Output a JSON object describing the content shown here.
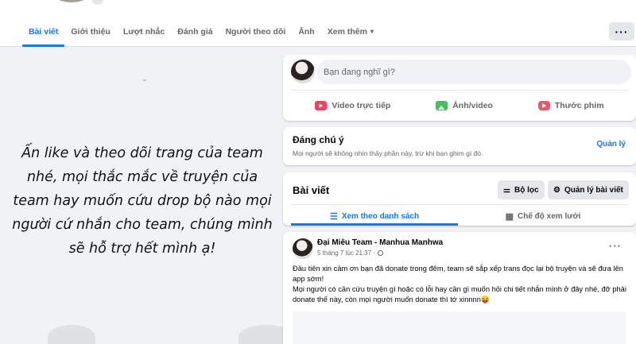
{
  "tabs": [
    {
      "label": "Bài viết",
      "active": true
    },
    {
      "label": "Giới thiệu"
    },
    {
      "label": "Lượt nhắc"
    },
    {
      "label": "Đánh giá"
    },
    {
      "label": "Người theo dõi"
    },
    {
      "label": "Ảnh"
    },
    {
      "label": "Xem thêm",
      "caret": "▾"
    }
  ],
  "more_button": "···",
  "left_banner": {
    "text": "Ấn like và theo dõi trang của team nhé, mọi thắc mắc về truyện của team hay muốn cứu drop bộ nào mọi người cứ nhắn cho team, chúng mình sẽ hỗ trợ hết mình ạ!"
  },
  "composer": {
    "placeholder": "Bạn đang nghĩ gì?",
    "actions": [
      {
        "label": "Video trực tiếp",
        "icon": "live-video-icon"
      },
      {
        "label": "Ảnh/video",
        "icon": "photo-icon"
      },
      {
        "label": "Thước phim",
        "icon": "reel-icon"
      }
    ]
  },
  "featured": {
    "title": "Đáng chú ý",
    "subtitle": "Mọi người sẽ không nhìn thấy phần này, trừ khi bạn ghim gì đó.",
    "manage": "Quản lý"
  },
  "posts_header": {
    "title": "Bài viết",
    "filter": "Bộ lọc",
    "manage": "Quản lý bài viết",
    "list_view": "Xem theo danh sách",
    "grid_view": "Chế độ xem lưới"
  },
  "post": {
    "author": "Đại Miêu Team - Manhua Manhwa",
    "time": "5 tháng 7 lúc 21:37 ·",
    "body_1": "Đầu tiên xin cảm ơn bạn đã donate trong đêm, team sẽ sắp xếp trans đọc lại bộ truyện và sẽ đưa lên app sớm!",
    "body_2": "Mọi người có cần cứu truyện gì hoặc có lỗi hay cần gì muốn hỏi chi tiết nhắn mình ở đây nhé, đỡ phải donate thế này, còn mọi người muốn donate thì tớ xinnnn😝"
  },
  "colors": {
    "accent": "#1877f2",
    "background": "#f0f2f5"
  }
}
